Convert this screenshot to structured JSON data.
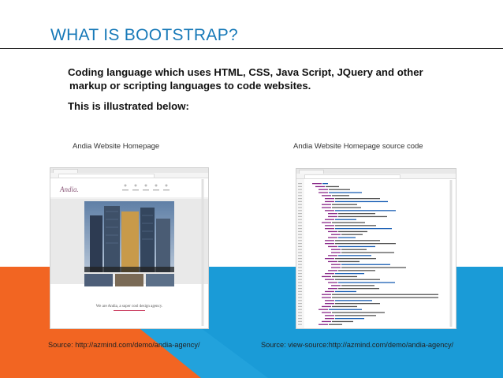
{
  "slide": {
    "title": "WHAT IS BOOTSTRAP?",
    "body_line1": "Coding language which uses HTML, CSS, Java Script, JQuery and other",
    "body_line2": "markup or scripting languages to code websites.",
    "body_line3": "This is illustrated below:",
    "caption_left": "Andia Website Homepage",
    "caption_right": "Andia Website Homepage source code",
    "source_left": "Source: http://azmind.com/demo/andia-agency/",
    "source_right": "Source: view-source:http://azmind.com/demo/andia-agency/"
  },
  "colors": {
    "title": "#1779b8",
    "band_blue": "#1a9bd7",
    "accent_orange": "#f26522"
  },
  "screenshots": {
    "left_icon": "website-homepage-screenshot",
    "right_icon": "source-code-screenshot",
    "left_logo_text": "Andia",
    "left_tagline": "We are Andia, a super cool design agency."
  }
}
